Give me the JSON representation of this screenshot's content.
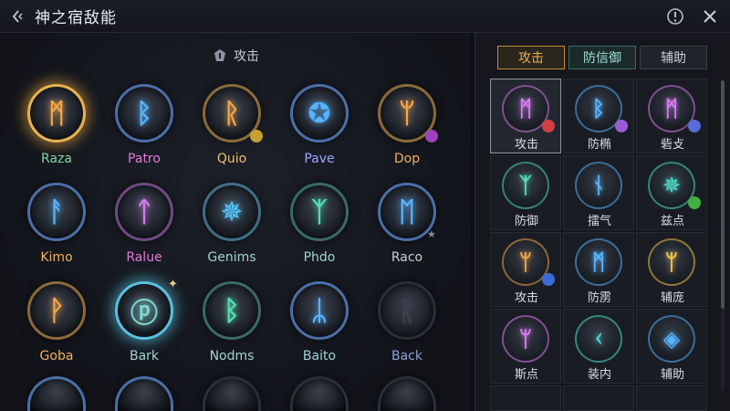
{
  "window": {
    "title": "神之宿敌能"
  },
  "left_panel": {
    "section_title": "攻击",
    "runes": [
      {
        "name": "Raza",
        "glyph": "ᛗ",
        "color": "#f2a545",
        "text_color": "#7fd7a2",
        "ring": "#e9b24f"
      },
      {
        "name": "Patro",
        "glyph": "ᛒ",
        "color": "#56b4ff",
        "text_color": "#e07ad6",
        "ring": "#4a6fa6"
      },
      {
        "name": "Quio",
        "glyph": "ᚱ",
        "color": "#f2a545",
        "text_color": "#e8c070",
        "ring": "#8a6a3a"
      },
      {
        "name": "Pave",
        "glyph": "✪",
        "color": "#56b4ff",
        "text_color": "#9fa6ff",
        "ring": "#4a6fa6"
      },
      {
        "name": "Dop",
        "glyph": "ᛘ",
        "color": "#f2a545",
        "text_color": "#f0b060",
        "ring": "#8a6a3a"
      },
      {
        "name": "Kimo",
        "glyph": "ᚨ",
        "color": "#56b4ff",
        "text_color": "#f0b060",
        "ring": "#4a6fa6"
      },
      {
        "name": "Ralue",
        "glyph": "ᛏ",
        "color": "#d77cf0",
        "text_color": "#e07ad6",
        "ring": "#6e4a80"
      },
      {
        "name": "Genims",
        "glyph": "✵",
        "color": "#56c9ff",
        "text_color": "#9fd3d8",
        "ring": "#3f6f86"
      },
      {
        "name": "Phdo",
        "glyph": "ᛉ",
        "color": "#4fe0b0",
        "text_color": "#9fd3d8",
        "ring": "#3a6a63"
      },
      {
        "name": "Raco",
        "glyph": "ᛖ",
        "color": "#56b4ff",
        "text_color": "#c9ced8",
        "ring": "#4a6fa6"
      },
      {
        "name": "Goba",
        "glyph": "ᚹ",
        "color": "#f2a545",
        "text_color": "#f0b060",
        "ring": "#8a6a3a"
      },
      {
        "name": "Bark",
        "glyph": "ⓟ",
        "color": "#7fd7d0",
        "text_color": "#9fd3d8",
        "ring": "#5ac0e0"
      },
      {
        "name": "Nodms",
        "glyph": "ᛒ",
        "color": "#4fe0b0",
        "text_color": "#9fd3d8",
        "ring": "#3a6a63"
      },
      {
        "name": "Baito",
        "glyph": "ᛦ",
        "color": "#56b4ff",
        "text_color": "#9fd3d8",
        "ring": "#4a6fa6"
      },
      {
        "name": "Back",
        "glyph": "ᚱ",
        "color": "#3b414d",
        "text_color": "#8fa0d8",
        "ring": "#2a2e37"
      }
    ]
  },
  "right_panel": {
    "tabs": [
      "攻击",
      "防信御",
      "辅助"
    ],
    "runes": [
      {
        "label": "攻击",
        "glyph": "ᛗ",
        "color": "#d77cf0",
        "badge_color": "#d04040"
      },
      {
        "label": "防椭",
        "glyph": "ᛒ",
        "color": "#56b4ff",
        "badge_color": "#9a5ad8"
      },
      {
        "label": "砦攴",
        "glyph": "ᛗ",
        "color": "#d77cf0",
        "badge_color": "#5a6ad8"
      },
      {
        "label": "防御",
        "glyph": "ᛉ",
        "color": "#4fe0b0",
        "badge_color": ""
      },
      {
        "label": "擂气",
        "glyph": "ᚾ",
        "color": "#56b4ff",
        "badge_color": ""
      },
      {
        "label": "兹点",
        "glyph": "✵",
        "color": "#4fe0d0",
        "badge_color": "#40b040"
      },
      {
        "label": "攻击",
        "glyph": "ᛘ",
        "color": "#f2a545",
        "badge_color": "#3a6ad8"
      },
      {
        "label": "防雳",
        "glyph": "ᛗ",
        "color": "#56b4ff",
        "badge_color": ""
      },
      {
        "label": "辅庞",
        "glyph": "ᛘ",
        "color": "#f2c545",
        "badge_color": ""
      },
      {
        "label": "斯点",
        "glyph": "ᛘ",
        "color": "#d77cf0",
        "badge_color": ""
      },
      {
        "label": "装内",
        "glyph": "ᚲ",
        "color": "#4fe0d0",
        "badge_color": ""
      },
      {
        "label": "辅助",
        "glyph": "◈",
        "color": "#56b4ff",
        "badge_color": ""
      }
    ]
  }
}
